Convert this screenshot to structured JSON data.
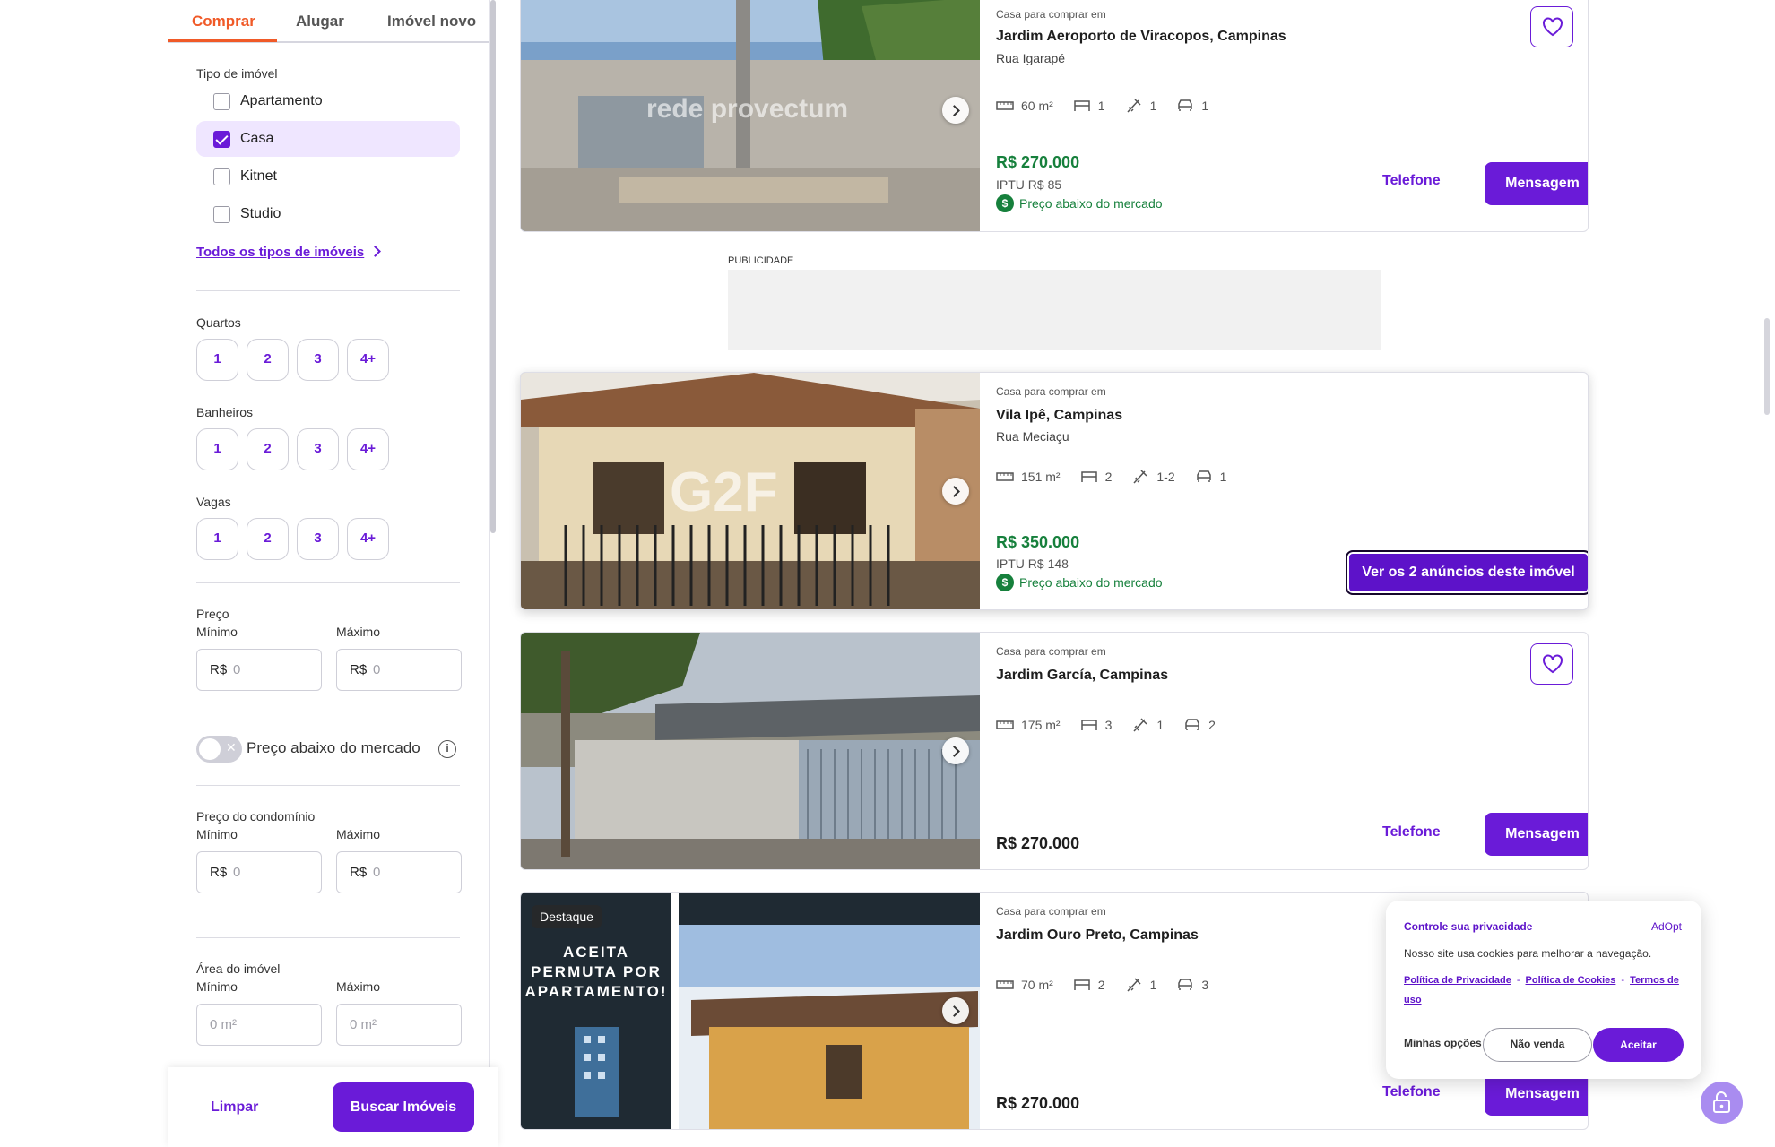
{
  "tabs": [
    {
      "label": "Comprar",
      "active": true
    },
    {
      "label": "Alugar",
      "active": false
    },
    {
      "label": "Imóvel novo",
      "active": false
    }
  ],
  "filters": {
    "property_type_label": "Tipo de imóvel",
    "property_types": [
      {
        "label": "Apartamento",
        "checked": false
      },
      {
        "label": "Casa",
        "checked": true
      },
      {
        "label": "Kitnet",
        "checked": false
      },
      {
        "label": "Studio",
        "checked": false
      }
    ],
    "all_types_link": "Todos os tipos de imóveis",
    "bedrooms_label": "Quartos",
    "bathrooms_label": "Banheiros",
    "parking_label": "Vagas",
    "count_options": [
      "1",
      "2",
      "3",
      "4+"
    ],
    "price_label": "Preço",
    "min_label": "Mínimo",
    "max_label": "Máximo",
    "currency": "R$",
    "price_placeholder": "0",
    "below_market_toggle": "Preço abaixo do mercado",
    "below_market_enabled": false,
    "toggle_x": "✕",
    "info": "i",
    "condo_label": "Preço do condomínio",
    "area_label": "Área do imóvel",
    "area_placeholder": "0 m²"
  },
  "bottom_bar": {
    "clear": "Limpar",
    "search": "Buscar Imóveis"
  },
  "ad": {
    "label": "PUBLICIDADE"
  },
  "listings": [
    {
      "kicker": "Casa para comprar em",
      "title": "Jardim Aeroporto de Viracopos, Campinas",
      "street": "Rua Igarapé",
      "area": "60 m²",
      "bedrooms": "1",
      "bathrooms": "1",
      "parking": "1",
      "price": "R$ 270.000",
      "iptu": "IPTU R$ 85",
      "badge": "Preço abaixo do mercado",
      "phone": "Telefone",
      "message": "Mensagem",
      "watermark": "rede provectum"
    },
    {
      "kicker": "Casa para comprar em",
      "title": "Vila Ipê, Campinas",
      "street": "Rua Meciaçu",
      "area": "151 m²",
      "bedrooms": "2",
      "bathrooms": "1-2",
      "parking": "1",
      "price": "R$ 350.000",
      "iptu": "IPTU R$ 148",
      "badge": "Preço abaixo do mercado",
      "ads_button": "Ver os 2 anúncios deste imóvel",
      "watermark": "G2F"
    },
    {
      "kicker": "Casa para comprar em",
      "title": "Jardim García, Campinas",
      "area": "175 m²",
      "bedrooms": "3",
      "bathrooms": "1",
      "parking": "2",
      "price": "R$ 270.000",
      "phone": "Telefone",
      "message": "Mensagem"
    },
    {
      "kicker": "Casa para comprar em",
      "title": "Jardim Ouro Preto, Campinas",
      "area": "70 m²",
      "bedrooms": "2",
      "bathrooms": "1",
      "parking": "3",
      "price": "R$ 270.000",
      "phone": "Telefone",
      "message": "Mensagem",
      "highlight": "Destaque",
      "promo_line1": "ACEITA",
      "promo_line2": "PERMUTA POR",
      "promo_line3": "APARTAMENTO!"
    }
  ],
  "privacy": {
    "title": "Controle sua privacidade",
    "brand": "AdOpt",
    "text": "Nosso site usa cookies para melhorar a navegação.",
    "link_privacy": "Política de Privacidade",
    "link_cookies": "Política de Cookies",
    "link_terms": "Termos de uso",
    "separator": "-",
    "my_options": "Minhas opções",
    "no_sell": "Não venda",
    "accept": "Aceitar"
  },
  "colors": {
    "accent": "#6a1bd8",
    "tab_active": "#f05a28",
    "price_green": "#16803c"
  }
}
